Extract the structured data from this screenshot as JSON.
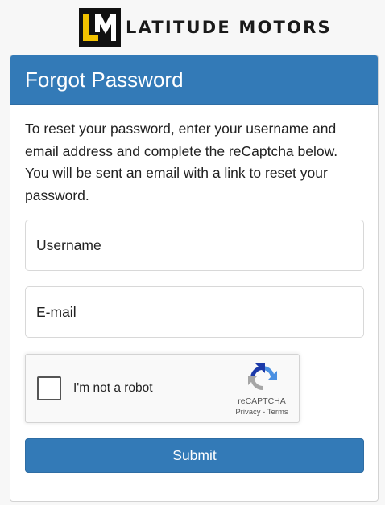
{
  "brand": {
    "name": "LATITUDE MOTORS",
    "logo_icon": "lm-monogram-icon",
    "accent_color": "#f2c200"
  },
  "panel": {
    "title": "Forgot Password",
    "intro": "To reset your password, enter your username and email address and complete the reCaptcha below. You will be sent an email with a link to reset your password.",
    "header_color": "#337ab7"
  },
  "form": {
    "username": {
      "placeholder": "Username",
      "value": ""
    },
    "email": {
      "placeholder": "E-mail",
      "value": ""
    },
    "submit_label": "Submit"
  },
  "captcha": {
    "label": "I'm not a robot",
    "checked": false,
    "brand": "reCAPTCHA",
    "privacy_label": "Privacy",
    "separator": " - ",
    "terms_label": "Terms",
    "icon": "recaptcha-icon"
  }
}
